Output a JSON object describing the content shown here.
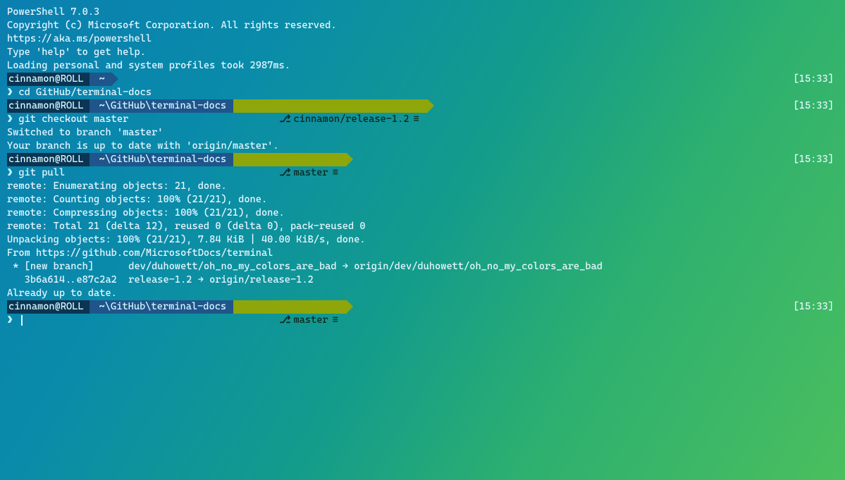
{
  "header": {
    "line1": "PowerShell 7.0.3",
    "line2": "Copyright (c) Microsoft Corporation. All rights reserved.",
    "blank1": " ",
    "link": "https://aka.ms/powershell",
    "help": "Type 'help' to get help.",
    "blank2": " ",
    "profiles": "Loading personal and system profiles took 2987ms."
  },
  "time": "[15:33]",
  "user": "cinnamon@ROLL",
  "p1": {
    "path": "~"
  },
  "cmd1": {
    "prompt": "❯",
    "text": "cd GitHub/terminal-docs"
  },
  "p2": {
    "path": "~\\GitHub\\terminal-docs",
    "branch": "cinnamon/release-1.2"
  },
  "cmd2": {
    "prompt": "❯",
    "text": "git checkout master"
  },
  "out2a": "Switched to branch 'master'",
  "out2b": "Your branch is up to date with 'origin/master'.",
  "p3": {
    "path": "~\\GitHub\\terminal-docs",
    "branch": "master"
  },
  "cmd3": {
    "prompt": "❯",
    "text": "git pull"
  },
  "pull": {
    "l1": "remote: Enumerating objects: 21, done.",
    "l2": "remote: Counting objects: 100% (21/21), done.",
    "l3": "remote: Compressing objects: 100% (21/21), done.",
    "l4": "remote: Total 21 (delta 12), reused 0 (delta 0), pack-reused 0",
    "l5": "Unpacking objects: 100% (21/21), 7.84 KiB | 40.00 KiB/s, done.",
    "l6": "From https://github.com/MicrosoftDocs/terminal",
    "l7": " * [new branch]      dev/duhowett/oh_no_my_colors_are_bad → origin/dev/duhowett/oh_no_my_colors_are_bad",
    "l8": "   3b6a614..e87c2a2  release-1.2 → origin/release-1.2",
    "l9": "Already up to date."
  },
  "p4": {
    "path": "~\\GitHub\\terminal-docs",
    "branch": "master"
  },
  "cmd4": {
    "prompt": "❯",
    "text": ""
  },
  "icons": {
    "branch": "⎇",
    "status": "≡"
  }
}
